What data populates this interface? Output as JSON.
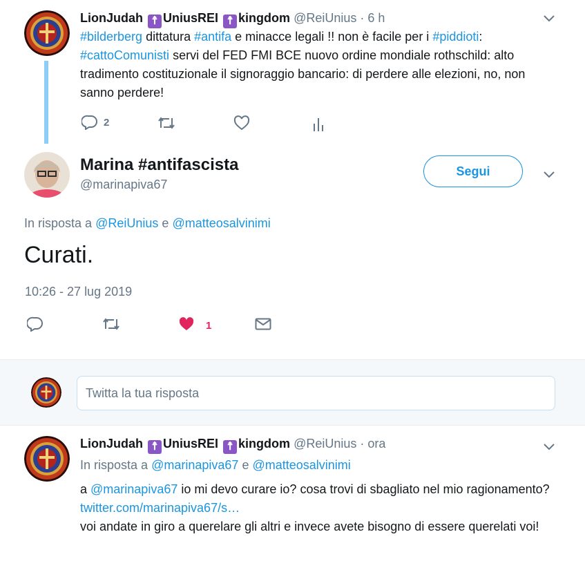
{
  "tweet1": {
    "name_part1": "LionJudah",
    "badge_glyph": "☨",
    "name_part2": "UniusREI",
    "name_part3": "kingdom",
    "handle": "@ReiUnius",
    "time": "· 6 h",
    "text": [
      {
        "t": "#bilderberg",
        "link": true
      },
      {
        "t": " dittatura ",
        "link": false
      },
      {
        "t": "#antifa",
        "link": true
      },
      {
        "t": " e minacce legali !! non è facile per i ",
        "link": false
      },
      {
        "t": "#piddioti",
        "link": true
      },
      {
        "t": ": ",
        "link": false
      },
      {
        "t": "#cattoComunisti",
        "link": true
      },
      {
        "t": " servi del FED FMI BCE nuovo ordine mondiale rothschild: alto tradimento costituzionale il signoraggio bancario: di perdere alle elezioni, no, non sanno perdere!",
        "link": false
      }
    ],
    "reply_count": "2",
    "icons": [
      "reply-icon",
      "retweet-icon",
      "like-icon",
      "analytics-icon"
    ]
  },
  "main_tweet": {
    "name": "Marina #antifascista",
    "handle": "@marinapiva67",
    "follow_label": "Segui",
    "reply_prefix": "In risposta a",
    "reply_to_1": "@ReiUnius",
    "reply_conj": "e",
    "reply_to_2": "@matteosalvinimi",
    "text": "Curati.",
    "timestamp": "10:26 - 27 lug 2019",
    "like_count": "1",
    "like_color": "#e0245e"
  },
  "reply_box": {
    "placeholder": "Twitta la tua risposta"
  },
  "tweet2": {
    "name_part1": "LionJudah",
    "name_part2": "UniusREI",
    "name_part3": "kingdom",
    "handle": "@ReiUnius",
    "time": "· ora",
    "reply_prefix": "In risposta a",
    "reply_to_1": "@marinapiva67",
    "reply_conj": "e",
    "reply_to_2": "@matteosalvinimi",
    "line1_a": "a ",
    "line1_mention": "@marinapiva67",
    "line1_b": " io mi devo curare io? cosa trovi di sbagliato nel mio ragionamento? ",
    "line1_link": "twitter.com/marinapiva67/s…",
    "line2": "voi andate in giro a querelare gli altri e invece avete bisogno di essere querelati voi!"
  },
  "colors": {
    "accent": "#1b95e0",
    "thread_line": "#8ecdf8",
    "grey": "#657786",
    "badge": "#8a56c6",
    "compose_bg": "#f5f8fa"
  }
}
